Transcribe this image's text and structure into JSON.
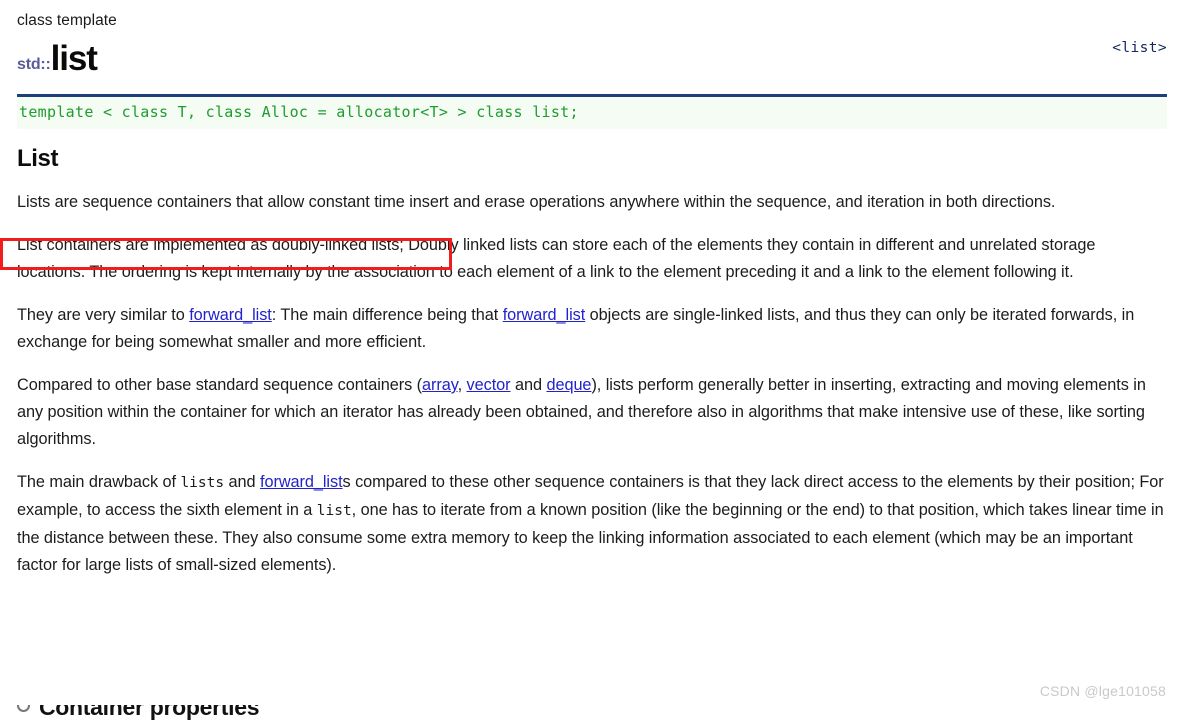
{
  "header": {
    "kind_label": "class template",
    "namespace": "std::",
    "name": "list",
    "include": "<list>"
  },
  "signature": {
    "code": "template < class T, class Alloc = allocator<T> > class list;"
  },
  "section": {
    "title": "List"
  },
  "paragraphs": {
    "p1": "Lists are sequence containers that allow constant time insert and erase operations anywhere within the sequence, and iteration in both directions.",
    "p2_a": "List containers are implemented as doubly-linked lists;",
    "p2_b": " Doubly linked lists can store each of the elements they contain in different and unrelated storage locations. The ordering is kept internally by the association to each element of a link to the element preceding it and a link to the element following it.",
    "p3_a": "They are very similar to ",
    "p3_link1": "forward_list",
    "p3_b": ": The main difference being that ",
    "p3_link2": "forward_list",
    "p3_c": " objects are single-linked lists, and thus they can only be iterated forwards, in exchange for being somewhat smaller and more efficient.",
    "p4_a": "Compared to other base standard sequence containers (",
    "p4_link1": "array",
    "p4_b": ", ",
    "p4_link2": "vector",
    "p4_c": " and ",
    "p4_link3": "deque",
    "p4_d": "), lists perform generally better in inserting, extracting and moving elements in any position within the container for which an iterator has already been obtained, and therefore also in algorithms that make intensive use of these, like sorting algorithms.",
    "p5_a": "The main drawback of ",
    "p5_code1": "lists",
    "p5_b": " and ",
    "p5_link1": "forward_list",
    "p5_c": "s compared to these other sequence containers is that they lack direct access to the elements by their position; For example, to access the sixth element in a ",
    "p5_code2": "list",
    "p5_d": ", one has to iterate from a known position (like the beginning or the end) to that position, which takes linear time in the distance between these. They also consume some extra memory to keep the linking information associated to each element (which may be an important factor for large lists of small-sized elements)."
  },
  "next_section": {
    "title": "Container properties"
  },
  "annotation": {
    "color": "#f11d1d",
    "target_text": "List containers are implemented as doubly-linked lists;"
  },
  "watermark": {
    "text": "CSDN @lge101058"
  },
  "colors": {
    "rule": "#1d3f7a",
    "code_green": "#1f9c2f",
    "code_bg": "#f4fcf4",
    "link": "#2222cc",
    "namespace": "#5a5a9c",
    "annotation_red": "#f11d1d"
  }
}
